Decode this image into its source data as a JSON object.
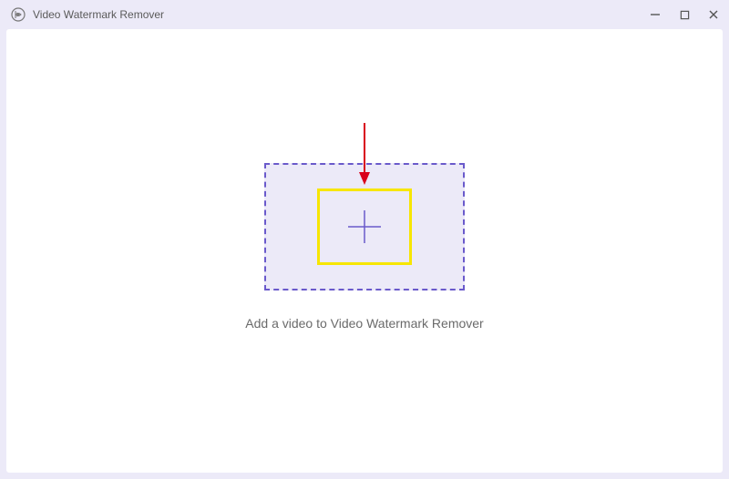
{
  "app": {
    "title": "Video Watermark Remover",
    "icon": "app-logo"
  },
  "window_controls": {
    "minimize": "minimize",
    "maximize": "maximize",
    "close": "close"
  },
  "main": {
    "instruction": "Add a video to Video Watermark Remover",
    "dropzone_icon": "plus-icon"
  },
  "annotation": {
    "arrow_color": "#d9001b",
    "highlight_color": "#f7e600"
  },
  "colors": {
    "accent": "#6a5acb",
    "background_light": "#eceaf8",
    "content_bg": "#ffffff"
  }
}
